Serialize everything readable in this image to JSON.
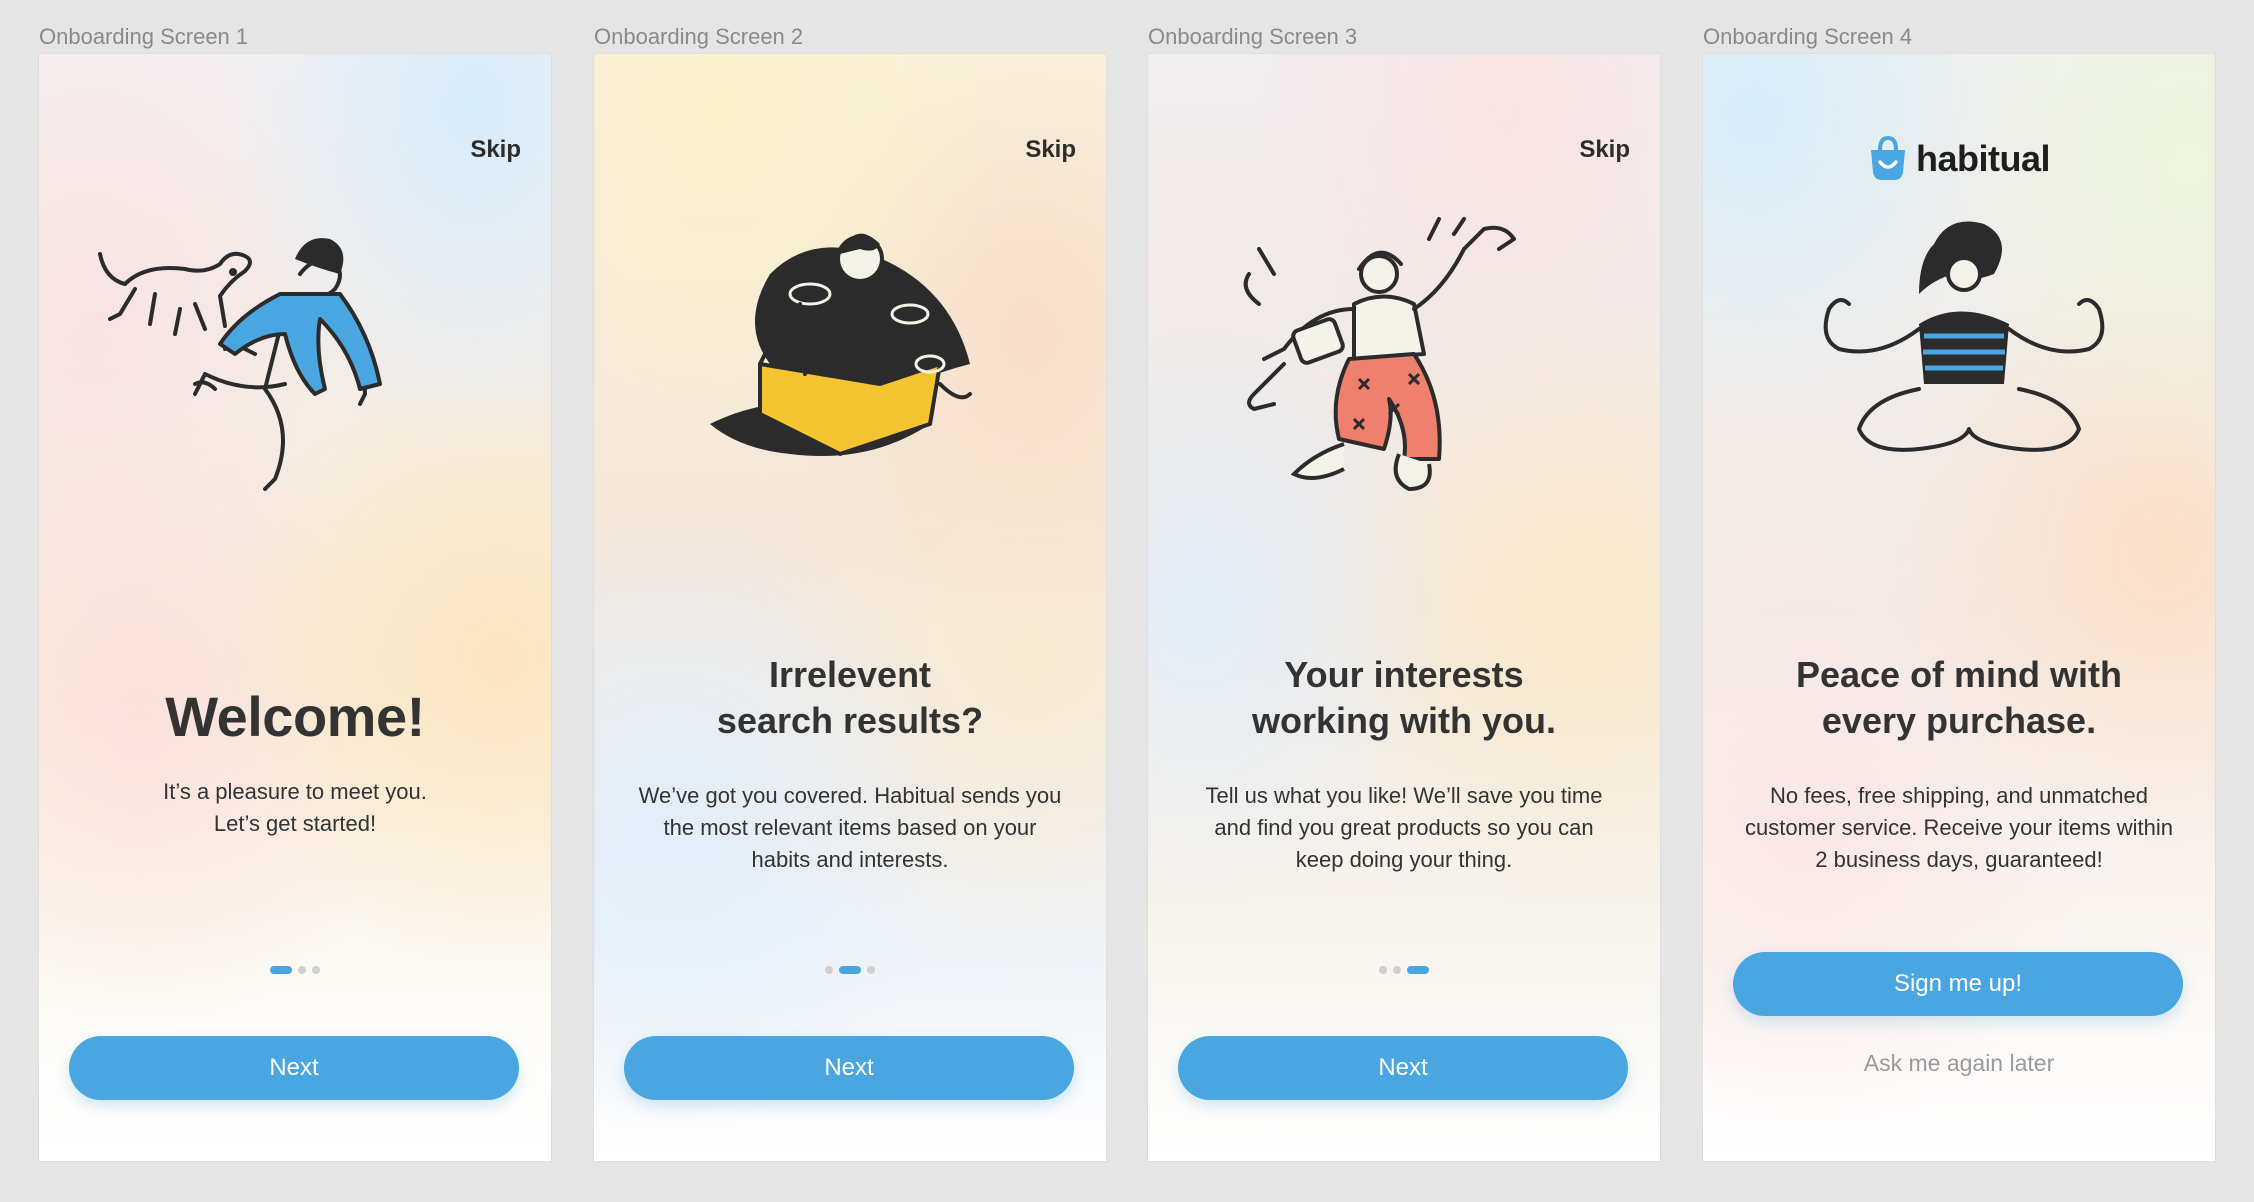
{
  "frames": [
    {
      "label": "Onboarding Screen 1",
      "skip": "Skip",
      "title_lines": [
        "Welcome!"
      ],
      "body_lines": [
        "It’s a pleasure to meet you.",
        "Let’s get started!"
      ],
      "pagination": {
        "current": 1,
        "total": 3
      },
      "button": "Next",
      "illustration": "person-jumping-with-dog"
    },
    {
      "label": "Onboarding Screen 2",
      "skip": "Skip",
      "title_lines": [
        "Irrelevent",
        "search results?"
      ],
      "body_lines": [
        "We’ve got you covered. Habitual sends you",
        "the most relevant items based on your",
        "habits and interests."
      ],
      "pagination": {
        "current": 2,
        "total": 3
      },
      "button": "Next",
      "illustration": "person-in-box-of-records"
    },
    {
      "label": "Onboarding Screen 3",
      "skip": "Skip",
      "title_lines": [
        "Your interests",
        "working with you."
      ],
      "body_lines": [
        "Tell us what you like! We’ll save you time",
        "and find you great products so you can",
        "keep doing your thing."
      ],
      "pagination": {
        "current": 3,
        "total": 3
      },
      "button": "Next",
      "illustration": "person-dancing-with-headphones"
    },
    {
      "label": "Onboarding Screen 4",
      "logo": {
        "text": "habitual",
        "icon": "shopping-bag-icon"
      },
      "title_lines": [
        "Peace of mind with",
        "every purchase."
      ],
      "body_lines": [
        "No fees, free shipping, and unmatched",
        "customer service. Receive your items within",
        "2 business days, guaranteed!"
      ],
      "button": "Sign me up!",
      "secondary_link": "Ask me again later",
      "illustration": "person-meditating"
    }
  ],
  "colors": {
    "accent": "#4AA6E0",
    "text": "#333333",
    "dot_inactive": "#CFCFCF",
    "illustration_yellow": "#F5C431",
    "illustration_coral": "#F0806E",
    "canvas": "#E5E5E5"
  }
}
